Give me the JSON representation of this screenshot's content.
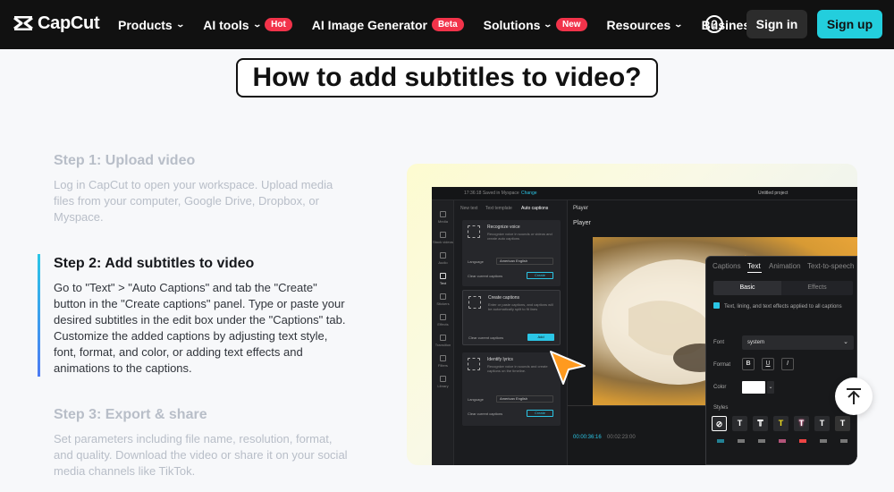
{
  "nav": {
    "brand": "CapCut",
    "items": [
      {
        "label": "Products",
        "chevron": true,
        "badge": ""
      },
      {
        "label": "AI tools",
        "chevron": true,
        "badge": "Hot"
      },
      {
        "label": "AI Image Generator",
        "chevron": false,
        "badge": "Beta"
      },
      {
        "label": "Solutions",
        "chevron": true,
        "badge": "New"
      },
      {
        "label": "Resources",
        "chevron": true,
        "badge": ""
      },
      {
        "label": "Business",
        "chevron": true,
        "badge": ""
      }
    ],
    "help_glyph": "?",
    "signin": "Sign in",
    "signup": "Sign up",
    "colors": {
      "signup_bg": "#23cedd",
      "badge_bg": "#f2334a",
      "nav_bg": "#111111"
    }
  },
  "headline": "How to add subtitles to video?",
  "steps": [
    {
      "title": "Step 1: Upload video",
      "body": "Log in CapCut to open your workspace. Upload media files from your computer, Google Drive, Dropbox, or Myspace.",
      "active": false
    },
    {
      "title": "Step 2: Add subtitles to video",
      "body": "Go to \"Text\" > \"Auto Captions\" and tab the \"Create\" button in the \"Create captions\" panel. Type or paste your desired subtitles in the edit box under the \"Captions\" tab. Customize the added captions by adjusting text style, font, format, and color, or adding text effects and animations to the captions.",
      "active": true
    },
    {
      "title": "Step 3: Export & share",
      "body": "Set parameters including file name, resolution, format, and quality. Download the video or share it on your social media channels like TikTok.",
      "active": false
    }
  ],
  "app": {
    "topbar_left": "17:36:18   Saved in Myspace",
    "topbar_link": "Change",
    "topbar_title": "Untitled project",
    "sidebar": [
      {
        "label": "Media",
        "active": false
      },
      {
        "label": "Stock videos",
        "active": false
      },
      {
        "label": "Audio",
        "active": false
      },
      {
        "label": "Text",
        "active": true
      },
      {
        "label": "Stickers",
        "active": false
      },
      {
        "label": "Effects",
        "active": false
      },
      {
        "label": "Transition",
        "active": false
      },
      {
        "label": "Filters",
        "active": false
      },
      {
        "label": "Library",
        "active": false
      }
    ],
    "caption_tabs": [
      "New text",
      "Text template",
      "Auto captions"
    ],
    "cards": [
      {
        "title": "Recognize voice",
        "desc": "Recognize voice in sounds or videos and create auto captions",
        "language_label": "Language",
        "language_value": "American English",
        "clear_label": "Clear current captions",
        "button": "Create"
      },
      {
        "title": "Create captions",
        "desc": "Enter or paste captions, and captions will be automatically split to fit lines",
        "clear_label": "Clear current captions",
        "button": "Add"
      },
      {
        "title": "Identify lyrics",
        "desc": "Recognize voice in sounds and create captions on the timeline.",
        "language_label": "Language",
        "language_value": "American English",
        "clear_label": "Clear current captions",
        "button": "Create"
      }
    ],
    "player_tab": "Player",
    "player_label": "Player",
    "timecode_current": "00:00:36:16",
    "timecode_total": "00:02:23:00"
  },
  "text_panel": {
    "tabs": [
      "Captions",
      "Text",
      "Animation",
      "Text-to-speech"
    ],
    "active_tab": "Text",
    "segments": [
      "Basic",
      "Effects"
    ],
    "active_segment": "Basic",
    "apply_all": "Text, lining, and text effects applied to all captions",
    "font_label": "Font",
    "font_value": "system",
    "format_label": "Format",
    "format_buttons": [
      "B",
      "U",
      "I"
    ],
    "color_label": "Color",
    "styles_label": "Styles",
    "style_swatches": [
      {
        "glyph": "⊘",
        "color": "#ffffff"
      },
      {
        "glyph": "T",
        "color": "#ffffff"
      },
      {
        "glyph": "T",
        "color": "#ffffff"
      },
      {
        "glyph": "T",
        "color": "#f5e11f"
      },
      {
        "glyph": "T",
        "color": "#f36ea1"
      },
      {
        "glyph": "T",
        "color": "#ffffff"
      },
      {
        "glyph": "T",
        "color": "#ffffff"
      }
    ]
  }
}
